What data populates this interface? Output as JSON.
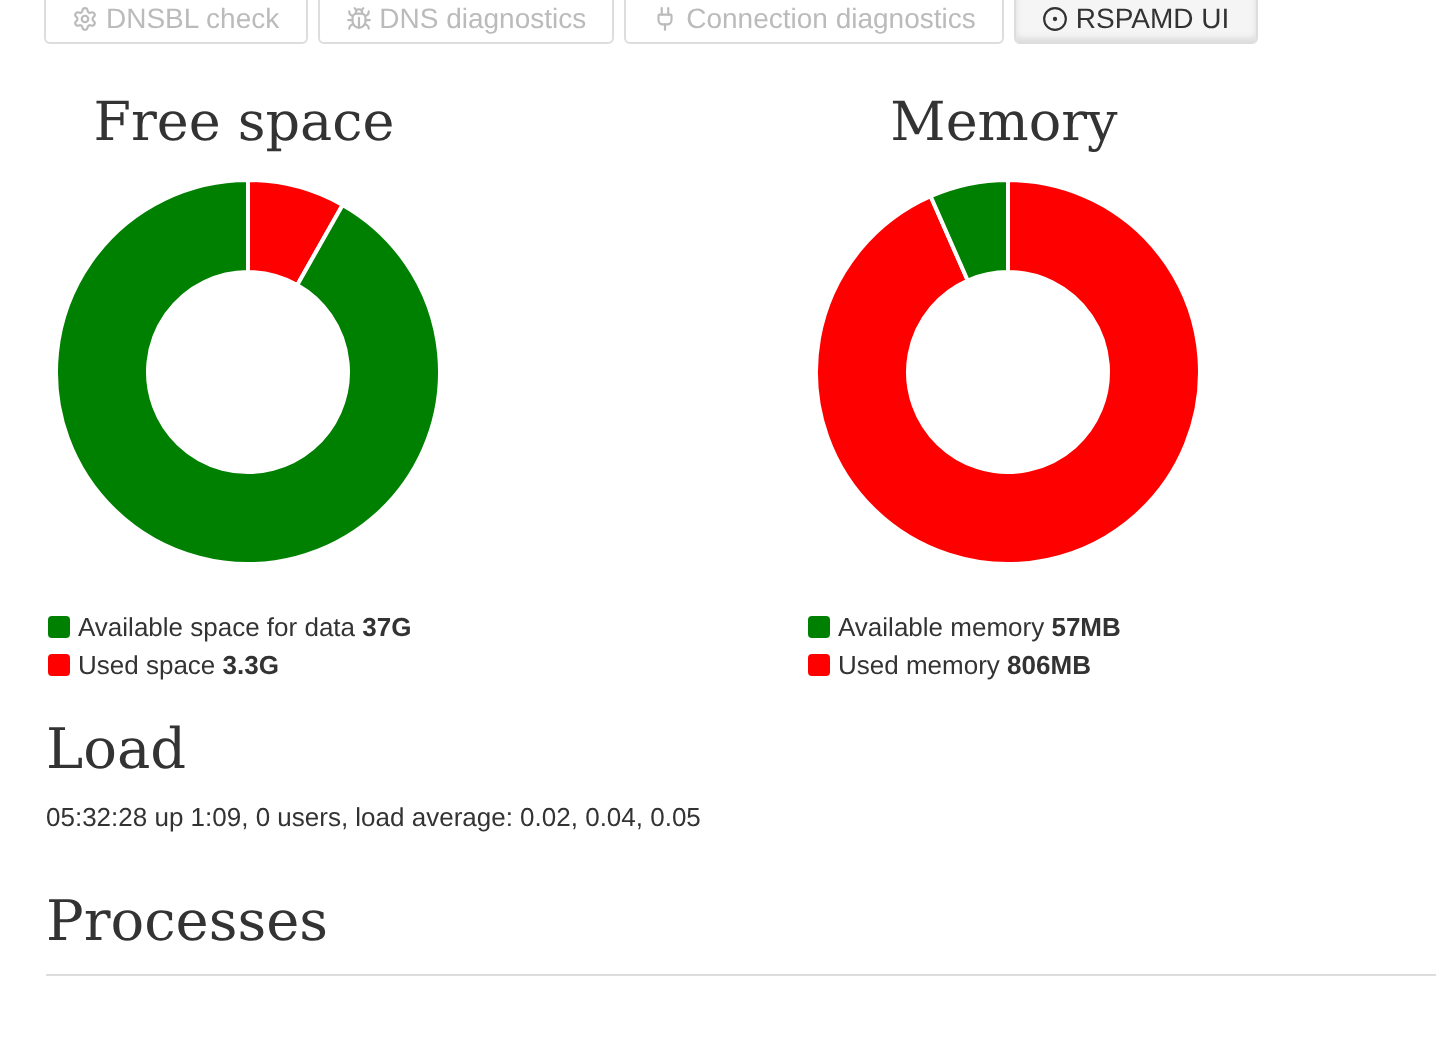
{
  "tabs": [
    {
      "label": "DNSBL check",
      "kind": "check",
      "selected": false
    },
    {
      "label": "DNS diagnostics",
      "kind": "dns",
      "selected": false
    },
    {
      "label": "Connection diagnostics",
      "kind": "connection",
      "selected": false
    },
    {
      "label": "RSPAMD UI",
      "kind": "rspamd",
      "selected": true
    }
  ],
  "charts": [
    {
      "title": "Free space",
      "legend_values": [
        "37G",
        "3.3G"
      ],
      "chart_data": {
        "type": "donut",
        "categories": [
          "Available space for data",
          "Used space"
        ],
        "values": [
          91.8,
          8.2
        ],
        "colors": [
          "#008000",
          "#ff0000"
        ]
      }
    },
    {
      "title": "Memory",
      "legend_values": [
        "57MB",
        "806MB"
      ],
      "chart_data": {
        "type": "donut",
        "categories": [
          "Available memory",
          "Used memory"
        ],
        "values": [
          6.6,
          93.4
        ],
        "colors": [
          "#008000",
          "#ff0000"
        ]
      }
    }
  ],
  "load": {
    "heading": "Load",
    "text": "05:32:28 up 1:09, 0 users, load average: 0.02, 0.04, 0.05"
  },
  "processes": {
    "heading": "Processes"
  }
}
